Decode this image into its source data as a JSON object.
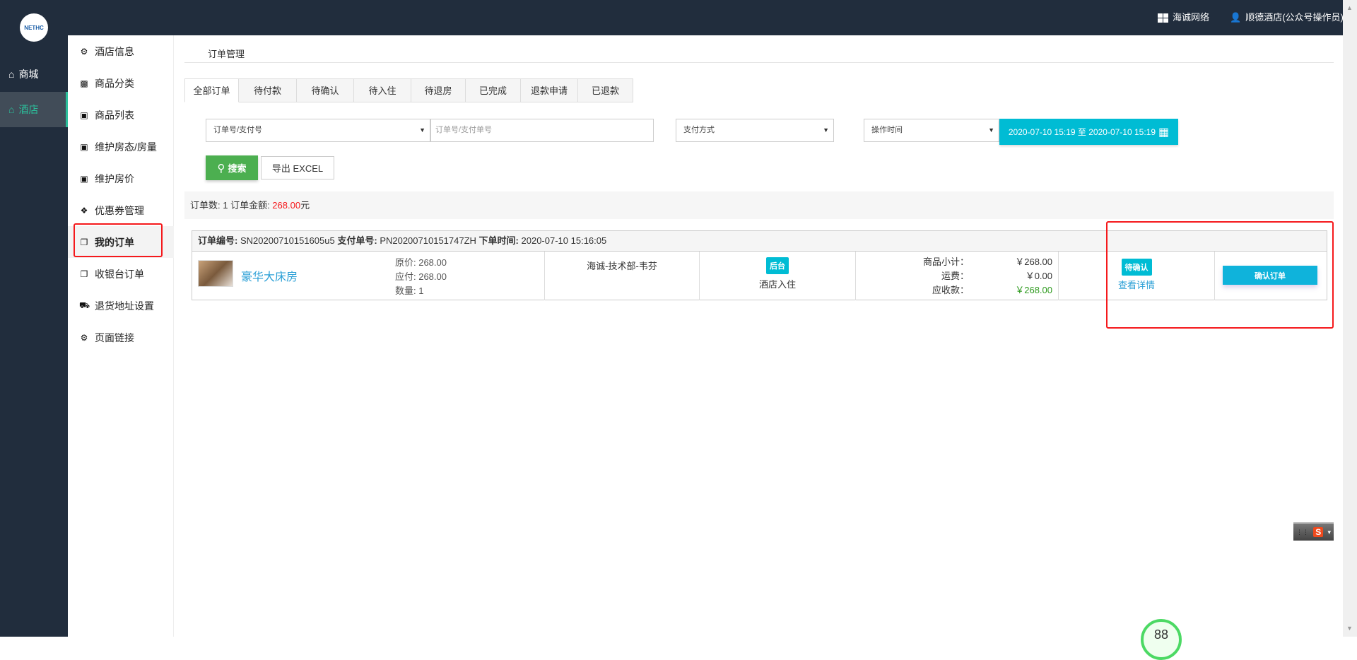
{
  "topbar": {
    "company_label": "海诚网络",
    "user_label": "顺德酒店(公众号操作员)"
  },
  "logo": {
    "text": "海诚科技 NETHC"
  },
  "main_nav": [
    {
      "label": "商城",
      "icon": "home-icon",
      "active": false
    },
    {
      "label": "酒店",
      "icon": "home-icon",
      "active": true
    }
  ],
  "sub_nav": [
    {
      "label": "酒店信息",
      "icon": "cogs-icon"
    },
    {
      "label": "商品分类",
      "icon": "sitemap-icon"
    },
    {
      "label": "商品列表",
      "icon": "cubes-icon"
    },
    {
      "label": "维护房态/房量",
      "icon": "cubes-icon"
    },
    {
      "label": "维护房价",
      "icon": "cubes-icon"
    },
    {
      "label": "优惠券管理",
      "icon": "tags-icon"
    },
    {
      "label": "我的订单",
      "icon": "copy-icon",
      "active": true
    },
    {
      "label": "收银台订单",
      "icon": "copy-icon"
    },
    {
      "label": "退货地址设置",
      "icon": "truck-icon"
    },
    {
      "label": "页面链接",
      "icon": "cogs-icon"
    }
  ],
  "breadcrumb": "订单管理",
  "tabs": [
    "全部订单",
    "待付款",
    "待确认",
    "待入住",
    "待退房",
    "已完成",
    "退款申请",
    "已退款"
  ],
  "filters": {
    "search_type": "订单号/支付号",
    "search_placeholder": "订单号/支付单号",
    "payment_method": "支付方式",
    "time_type": "操作时间",
    "date_range": "2020-07-10 15:19 至 2020-07-10 15:19",
    "search_button": "搜索",
    "export_button": "导出 EXCEL"
  },
  "summary": {
    "prefix": "订单数: 1 订单金额: ",
    "amount": "268.00",
    "suffix": "元"
  },
  "order": {
    "order_no_label": "订单编号:",
    "order_no": "SN20200710151605u5",
    "pay_no_label": "支付单号:",
    "pay_no": "PN20200710151747ZH",
    "time_label": "下单时间:",
    "time": "2020-07-10 15:16:05",
    "product_name": "豪华大床房",
    "original_price": "原价: 268.00",
    "payable": "应付: 268.00",
    "quantity": "数量: 1",
    "customer": "海诚-技术部-韦芬",
    "source_badge": "后台",
    "source_type": "酒店入住",
    "subtotal_label": "商品小计：",
    "subtotal": "￥268.00",
    "shipping_label": "运费：",
    "shipping": "￥0.00",
    "receivable_label": "应收款：",
    "receivable": "￥268.00",
    "status_badge": "待确认",
    "detail_link": "查看详情",
    "confirm_button": "确认订单"
  },
  "gauge_value": "88",
  "colors": {
    "sidebar": "#212d3d",
    "accent_green": "#2bbf9b",
    "cyan": "#00bcd4",
    "red": "#f5191c"
  }
}
